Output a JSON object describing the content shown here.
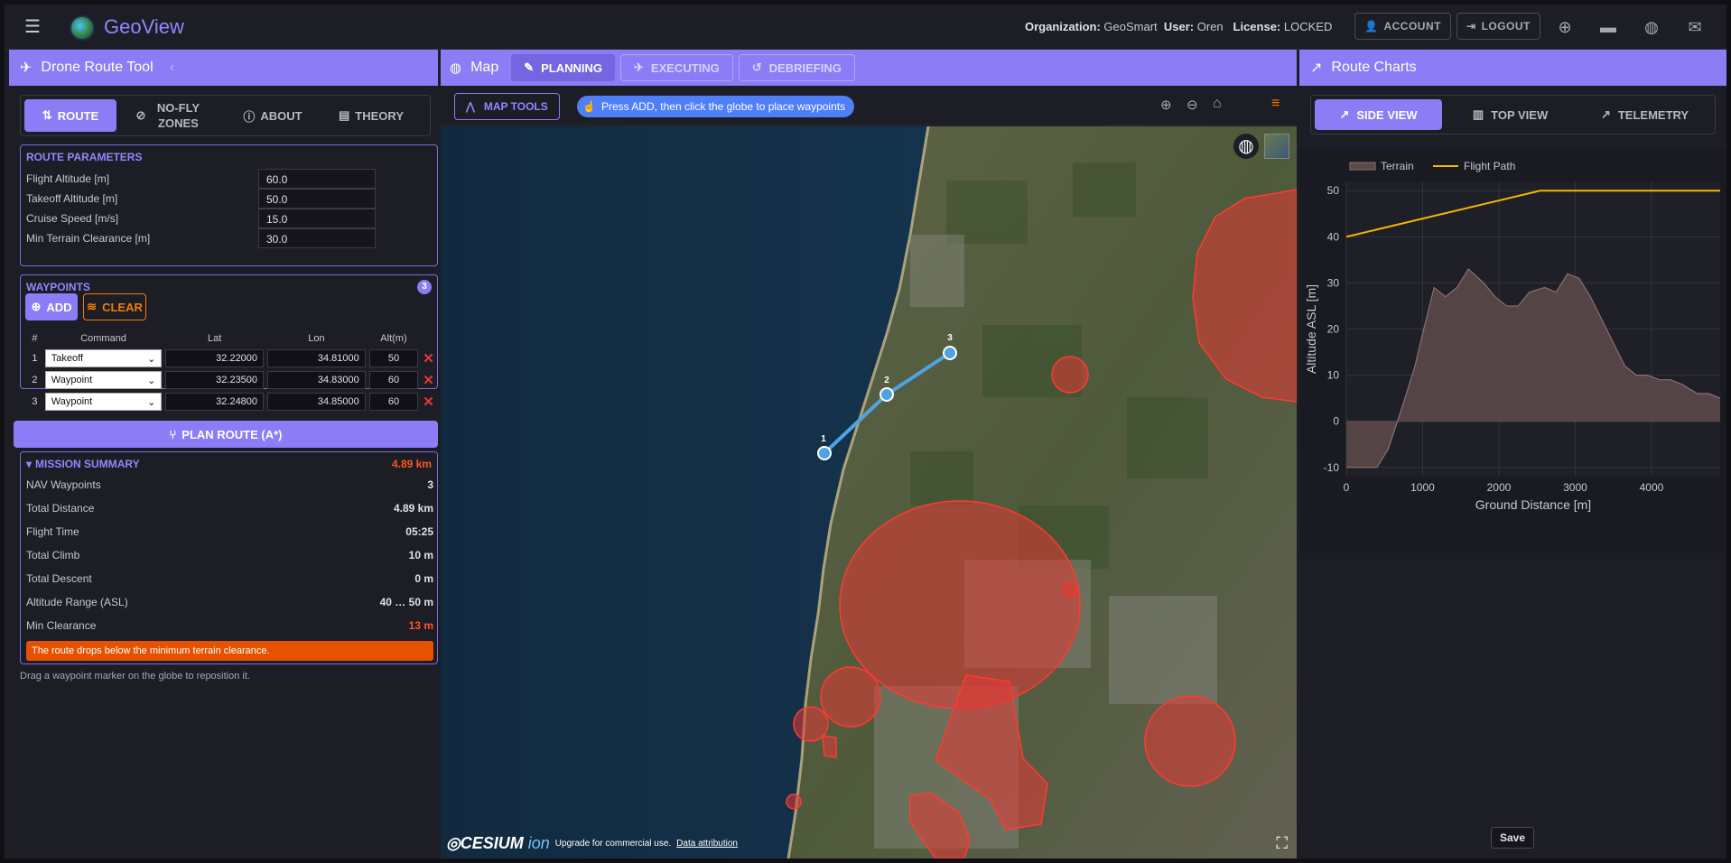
{
  "app": {
    "brand": "GeoView",
    "org_label": "Organization:",
    "org_value": "GeoSmart",
    "user_label": "User:",
    "user_value": "Oren",
    "license_label": "License:",
    "license_value": "LOCKED",
    "account_label": "ACCOUNT",
    "logout_label": "LOGOUT"
  },
  "left": {
    "title": "Drone Route Tool",
    "tabs": [
      {
        "label": "ROUTE",
        "icon": "route-icon",
        "active": true
      },
      {
        "label": "NO-FLY ZONES",
        "icon": "block-icon",
        "active": false
      },
      {
        "label": "ABOUT",
        "icon": "info-icon",
        "active": false
      },
      {
        "label": "THEORY",
        "icon": "book-icon",
        "active": false
      }
    ],
    "params": {
      "title": "ROUTE PARAMETERS",
      "rows": [
        {
          "label": "Flight Altitude [m]",
          "value": "60.0"
        },
        {
          "label": "Takeoff Altitude [m]",
          "value": "50.0"
        },
        {
          "label": "Cruise Speed [m/s]",
          "value": "15.0"
        },
        {
          "label": "Min Terrain Clearance [m]",
          "value": "30.0"
        }
      ]
    },
    "waypoints": {
      "title": "WAYPOINTS",
      "count": "3",
      "add_label": "ADD",
      "clear_label": "CLEAR",
      "headers": [
        "#",
        "Command",
        "Lat",
        "Lon",
        "Alt(m)"
      ],
      "rows": [
        {
          "n": "1",
          "cmd": "Takeoff",
          "lat": "32.22000",
          "lon": "34.81000",
          "alt": "50"
        },
        {
          "n": "2",
          "cmd": "Waypoint",
          "lat": "32.23500",
          "lon": "34.83000",
          "alt": "60"
        },
        {
          "n": "3",
          "cmd": "Waypoint",
          "lat": "32.24800",
          "lon": "34.85000",
          "alt": "60"
        }
      ]
    },
    "plan_label": "PLAN ROUTE (A*)",
    "summary": {
      "title": "MISSION SUMMARY",
      "headline": "4.89 km",
      "rows": [
        {
          "label": "NAV Waypoints",
          "value": "3",
          "warn": false
        },
        {
          "label": "Total Distance",
          "value": "4.89 km",
          "warn": false
        },
        {
          "label": "Flight Time",
          "value": "05:25",
          "warn": false
        },
        {
          "label": "Total Climb",
          "value": "10 m",
          "warn": false
        },
        {
          "label": "Total Descent",
          "value": "0 m",
          "warn": false
        },
        {
          "label": "Altitude Range (ASL)",
          "value": "40 … 50 m",
          "warn": false
        },
        {
          "label": "Min Clearance",
          "value": "13 m",
          "warn": true
        }
      ],
      "warning": "The route drops below the minimum terrain clearance."
    },
    "hint": "Drag a waypoint marker on the globe to reposition it."
  },
  "map": {
    "title": "Map",
    "tabs": [
      {
        "label": "PLANNING",
        "active": true
      },
      {
        "label": "EXECUTING",
        "active": false
      },
      {
        "label": "DEBRIEFING",
        "active": false
      }
    ],
    "map_tools_label": "MAP TOOLS",
    "hint": "Press ADD, then click the globe to place waypoints",
    "markers": [
      "1",
      "2",
      "3"
    ],
    "cesium_text": "CESIUM",
    "cesium_ion": "ion",
    "upgrade_text": "Upgrade for commercial use.",
    "attribution_text": "Data attribution",
    "colors": {
      "zone": "#e53935",
      "route": "#4fa3e0"
    }
  },
  "charts": {
    "title": "Route Charts",
    "tabs": [
      {
        "label": "SIDE VIEW",
        "active": true
      },
      {
        "label": "TOP VIEW",
        "active": false
      },
      {
        "label": "TELEMETRY",
        "active": false
      }
    ],
    "save_label": "Save"
  },
  "chart_data": {
    "type": "area",
    "xlabel": "Ground Distance [m]",
    "ylabel": "Altitude ASL [m]",
    "xlim": [
      0,
      4900
    ],
    "ylim": [
      -12,
      52
    ],
    "x_ticks": [
      0,
      1000,
      2000,
      3000,
      4000
    ],
    "y_ticks": [
      -10,
      0,
      10,
      20,
      30,
      40,
      50
    ],
    "legend": "top-left",
    "series": [
      {
        "name": "Terrain",
        "type": "area",
        "color": "#8a7070",
        "x": [
          0,
          400,
          550,
          650,
          750,
          900,
          1000,
          1150,
          1300,
          1450,
          1600,
          1800,
          1950,
          2100,
          2250,
          2400,
          2600,
          2750,
          2900,
          3050,
          3200,
          3350,
          3500,
          3650,
          3800,
          3950,
          4100,
          4250,
          4400,
          4600,
          4750,
          4900
        ],
        "y": [
          -10,
          -10,
          -6,
          -1,
          4,
          12,
          19,
          29,
          27,
          29,
          33,
          30,
          27,
          25,
          25,
          28,
          29,
          28,
          32,
          31,
          27,
          22,
          17,
          12,
          10,
          10,
          9,
          9,
          8,
          6,
          6,
          5
        ]
      },
      {
        "name": "Flight Path",
        "type": "line",
        "color": "#f5b800",
        "x": [
          0,
          2540,
          4900
        ],
        "y": [
          40,
          50,
          50
        ]
      }
    ]
  }
}
